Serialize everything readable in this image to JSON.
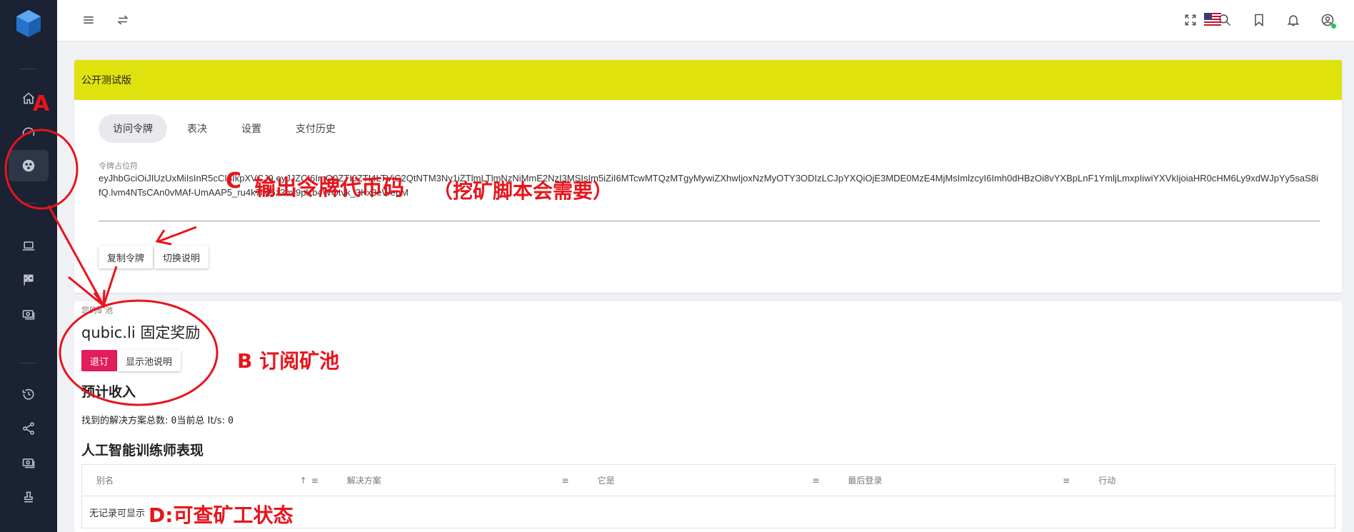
{
  "topbar": {
    "icons": [
      "menu-icon",
      "swap-icon",
      "flag-us-icon",
      "fullscreen-icon",
      "search-icon",
      "bookmark-icon",
      "bell-icon",
      "account-icon"
    ]
  },
  "sidebar": {
    "icons": [
      "logo-cube",
      "home-icon",
      "speedometer-icon",
      "pool-icon",
      "laptop-icon",
      "checkered-flag-icon",
      "cash-icon",
      "history-icon",
      "share-icon",
      "payment-icon",
      "stamp-icon"
    ]
  },
  "beta": {
    "banner": "公开测试版",
    "tabs": [
      "访问令牌",
      "表决",
      "设置",
      "支付历史"
    ],
    "token_label": "令牌占位符",
    "token_value": "eyJhbGciOiJIUzUxMiIsInR5cCI6IkpXVCJ9.eyJJZCI6ImQ0ZTI0ZTI4LTViC2QtNTM3Ny1iZTlmLTlmNzNiMmE2NzI3MSIsIm5iZiI6MTcwMTQzMTgyMywiZXhwIjoxNzMyOTY3ODIzLCJpYXQiOjE3MDE0MzE4MjMsImlzcyI6Imh0dHBzOi8vYXBpLnF1YmljLmxpIiwiYXVkIjoiaHR0cHM6Ly9xdWJpYy5saS8ifQ.lvm4NTsCAn0vMAf-UmAAP5_ru4k7iM5z3mf9pKb4WOtvk_3Kx3eWepM",
    "copy_button": "复制令牌",
    "toggle_button": "切换说明"
  },
  "pool": {
    "small_label": "您的矿池",
    "title": "qubic.li 固定奖励",
    "unsubscribe_button": "退订",
    "show_button": "显示池说明",
    "est_title": "预计收入",
    "solutions_label": "找到的解决方案总数:",
    "solutions_value": "0",
    "its_label": "当前总 It/s:",
    "its_value": "0",
    "ai_title": "人工智能训练师表现",
    "columns": [
      "别名",
      "解决方案",
      "它是",
      "最后登录",
      "行动"
    ],
    "empty_text": "无记录可显示"
  },
  "annotations": {
    "a": "A",
    "b": "B  订阅矿池",
    "c_letter": "C",
    "c_text": "输出令牌代币码",
    "c_note": "（挖矿脚本会需要）",
    "d": "D:可查矿工状态"
  },
  "colors": {
    "sidebar_bg": "#1a2233",
    "beta_banner": "#dfe20d",
    "unsubscribe": "#e11e5a",
    "annotation": "#e8141c",
    "online_dot": "#22c55e"
  }
}
